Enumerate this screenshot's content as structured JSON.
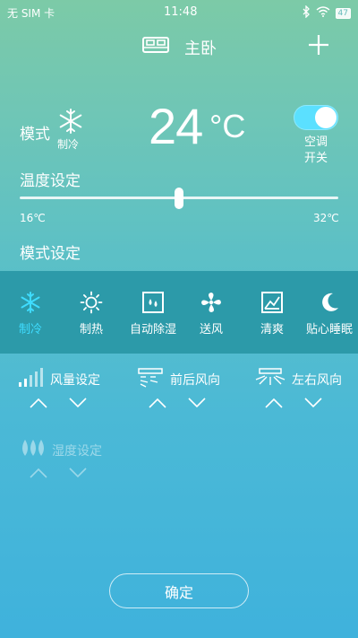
{
  "status_bar": {
    "carrier": "无 SIM 卡",
    "time": "11:48",
    "battery": "47"
  },
  "header": {
    "title": "主卧"
  },
  "mode": {
    "label": "模式",
    "value": "制冷"
  },
  "temperature": {
    "value": "24",
    "unit": "°C",
    "setpoint_fraction": 0.5
  },
  "power": {
    "label_line1": "空调",
    "label_line2": "开关",
    "on": true
  },
  "temp_setting": {
    "label": "温度设定",
    "min": "16℃",
    "max": "32℃"
  },
  "mode_setting": {
    "label": "模式设定",
    "modes": [
      {
        "label": "制冷",
        "icon": "snowflake-icon",
        "active": true
      },
      {
        "label": "制热",
        "icon": "sun-icon",
        "active": false
      },
      {
        "label": "自动除湿",
        "icon": "droplets-icon",
        "active": false
      },
      {
        "label": "送风",
        "icon": "fan-icon",
        "active": false
      },
      {
        "label": "清爽",
        "icon": "fresh-icon",
        "active": false
      },
      {
        "label": "贴心睡眠",
        "icon": "moon-icon",
        "active": false
      }
    ]
  },
  "settings": {
    "fan_speed": "风量设定",
    "vertical_swing": "前后风向",
    "horizontal_swing": "左右风向",
    "humidity": "湿度设定"
  },
  "confirm": {
    "label": "确定"
  },
  "colors": {
    "active_mode": "#3fdcff",
    "toggle_on": "#5be0ff",
    "mode_band": "#2c9aa9"
  }
}
